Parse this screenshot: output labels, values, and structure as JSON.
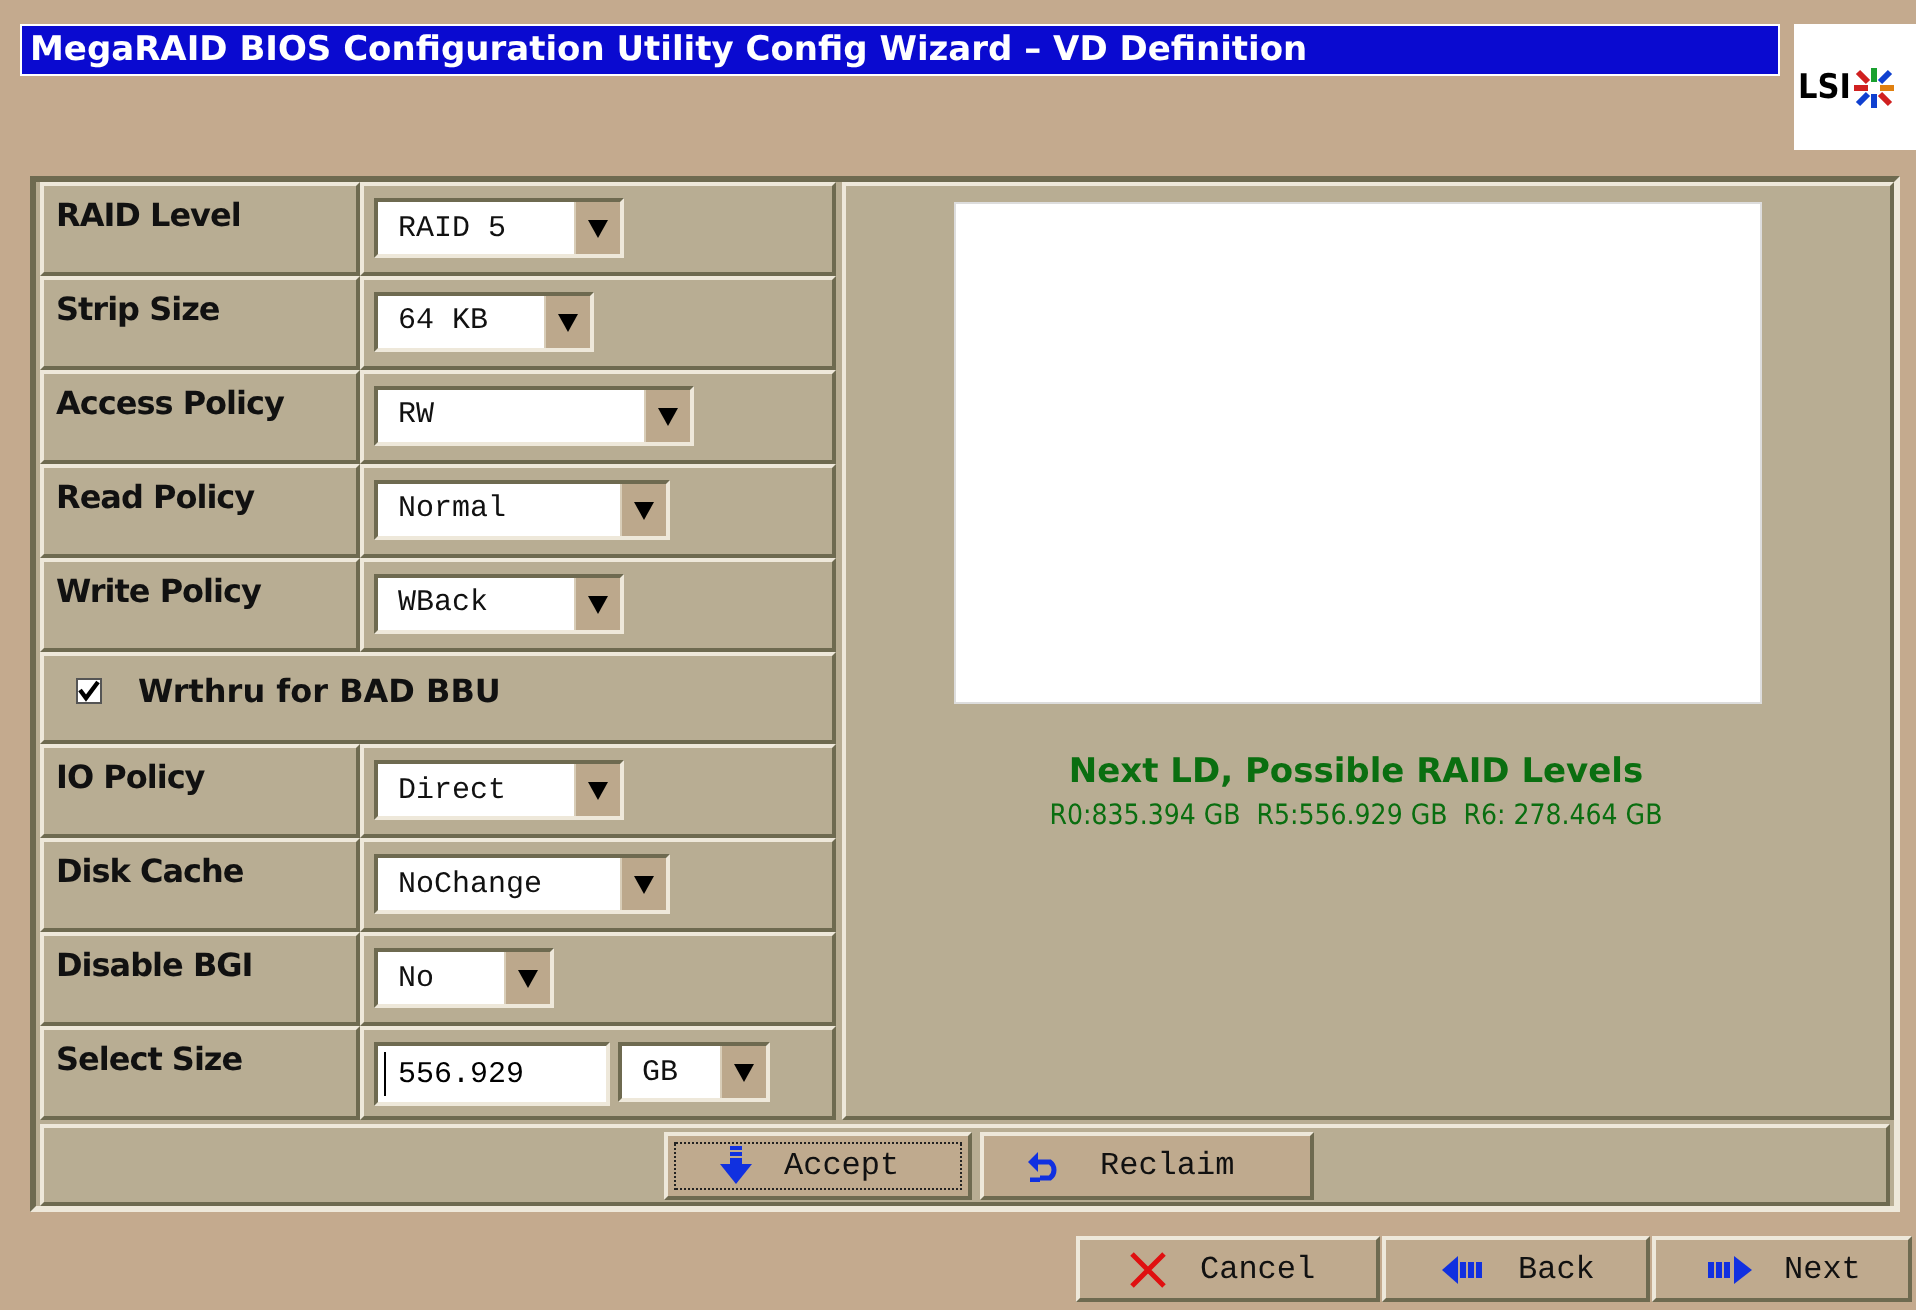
{
  "window": {
    "title": "MegaRAID BIOS Configuration Utility  Config Wizard – VD Definition",
    "logo": "LSI"
  },
  "fields": [
    {
      "kind": "dropdown",
      "label": "RAID Level",
      "value": "RAID 5"
    },
    {
      "kind": "dropdown",
      "label": "Strip Size",
      "value": "64 KB"
    },
    {
      "kind": "dropdown",
      "label": "Access Policy",
      "value": "RW"
    },
    {
      "kind": "dropdown",
      "label": "Read Policy",
      "value": "Normal"
    },
    {
      "kind": "dropdown",
      "label": "Write Policy",
      "value": "WBack"
    },
    {
      "kind": "checkbox",
      "label": "Wrthru for BAD BBU",
      "checked": true
    },
    {
      "kind": "dropdown",
      "label": "IO Policy",
      "value": "Direct"
    },
    {
      "kind": "dropdown",
      "label": "Disk Cache",
      "value": "NoChange"
    },
    {
      "kind": "dropdown",
      "label": "Disable BGI",
      "value": "No"
    },
    {
      "kind": "size",
      "label": "Select Size",
      "value": "556.929",
      "unit": "GB"
    }
  ],
  "raid_levels": {
    "title": "Next LD, Possible RAID Levels",
    "sizes": "R0:835.394 GB  R5:556.929 GB  R6: 278.464 GB"
  },
  "actions": [
    {
      "kind": "accept",
      "label": "Accept",
      "focused": true
    },
    {
      "kind": "reclaim",
      "label": "Reclaim",
      "focused": false
    }
  ],
  "navigation": [
    {
      "kind": "cancel",
      "label": "Cancel"
    },
    {
      "kind": "back",
      "label": "Back"
    },
    {
      "kind": "next",
      "label": "Next"
    }
  ]
}
